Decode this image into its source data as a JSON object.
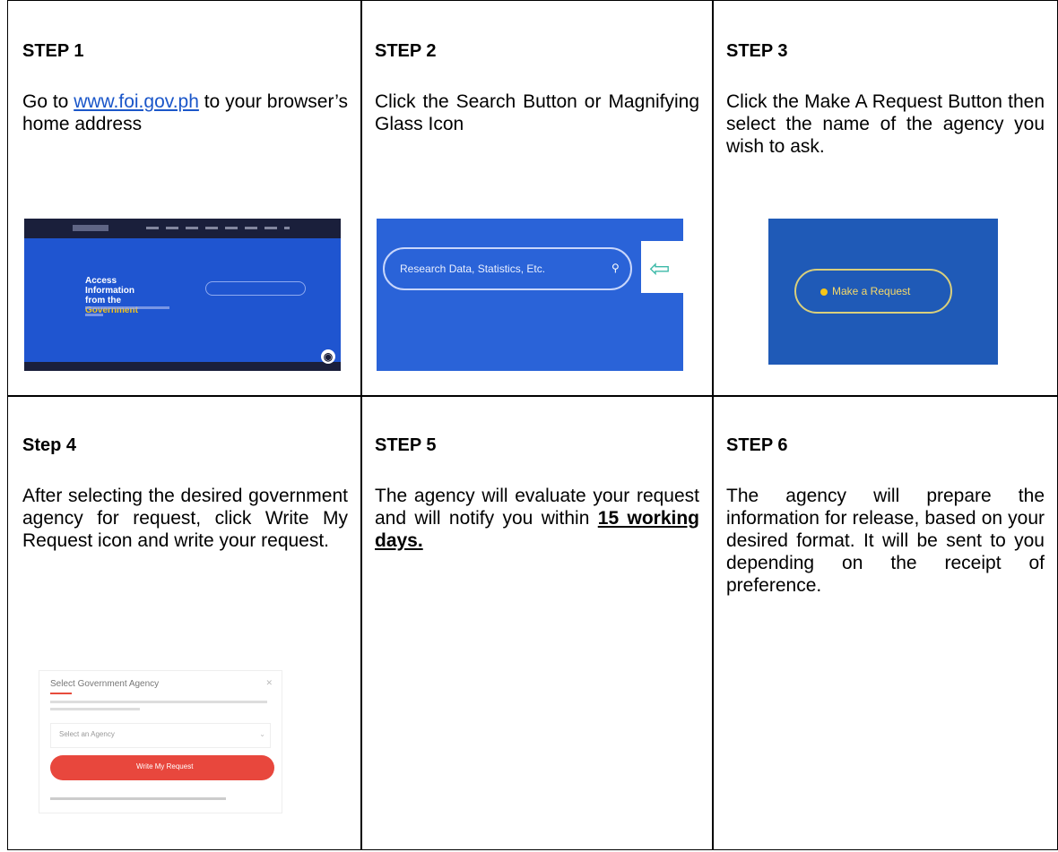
{
  "steps": [
    {
      "title": "STEP 1",
      "pre": "Go to ",
      "link": "www.foi.gov.ph",
      "post": " to your browser’s home address"
    },
    {
      "title": "STEP 2",
      "text": "Click the Search Button or Magnifying Glass Icon"
    },
    {
      "title": "STEP 3",
      "text": "Click the Make A Request Button then select the name of the agency you wish to ask."
    },
    {
      "title": "Step 4",
      "text": "After selecting the desired government agency for request, click Write My Request icon and write your request."
    },
    {
      "title": "STEP 5",
      "pre": "The agency will evaluate your request and will notify you within ",
      "bold": "15 working days."
    },
    {
      "title": "STEP 6",
      "text": "The agency will prepare the information for release, based on your desired format. It will be sent to you depending on the receipt of preference."
    }
  ],
  "shots": {
    "step1": {
      "hero_line1": "Access Information",
      "hero_line2a": "from the ",
      "hero_line2b": "Government"
    },
    "step2": {
      "search_placeholder": "Research Data, Statistics, Etc."
    },
    "step3": {
      "button": "Make a Request"
    },
    "step4": {
      "title": "Select Government Agency",
      "select": "Select an Agency",
      "button": "Write My Request"
    }
  },
  "colors": {
    "link": "#1a56c9",
    "hero_blue": "#1f55d0",
    "accent_yellow": "#f5c518",
    "button_red": "#e8473d"
  }
}
